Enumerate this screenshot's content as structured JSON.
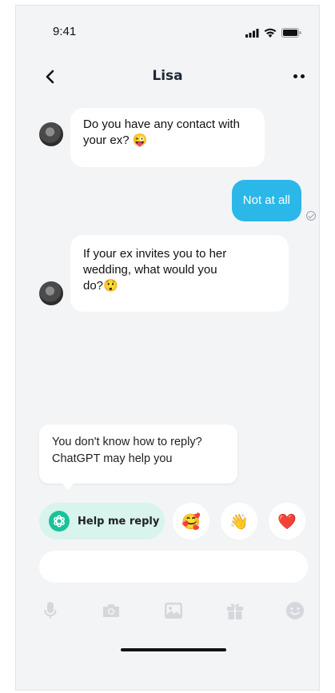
{
  "status_bar": {
    "time": "9:41",
    "icons": [
      "signal-icon",
      "wifi-icon",
      "battery-icon"
    ]
  },
  "header": {
    "title": "Lisa",
    "back_icon": "chevron-left-icon",
    "more_icon": "more-icon"
  },
  "messages": [
    {
      "direction": "incoming",
      "line1": "Do you have any contact with",
      "line2": "your ex? 😜"
    },
    {
      "direction": "outgoing",
      "text": "Not at all",
      "status": "read"
    },
    {
      "direction": "incoming",
      "line1": "If your ex invites you to her",
      "line2": "wedding, what would you",
      "line3": "do?😲"
    }
  ],
  "hint": {
    "line1": "You don't know how to reply?",
    "line2": "ChatGPT may help you"
  },
  "actions": {
    "help_label": "Help me reply",
    "emojis": [
      "🥰",
      "👋",
      "❤️"
    ]
  },
  "composer": {
    "value": ""
  },
  "toolbar": [
    "microphone-icon",
    "camera-icon",
    "image-icon",
    "gift-icon",
    "emoji-icon"
  ],
  "colors": {
    "outgoing_bubble": "#2bb8e8",
    "help_button": "#d9f3ed",
    "chatgpt_green": "#19c39a",
    "background": "#f3f4f6"
  }
}
